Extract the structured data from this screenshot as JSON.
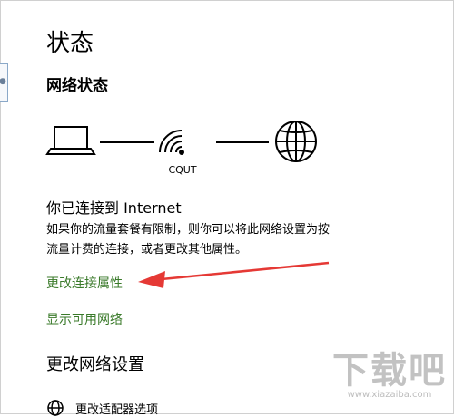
{
  "page": {
    "title": "状态"
  },
  "network_status": {
    "section_title": "网络状态",
    "ssid": "CQUT",
    "heading": "你已连接到 Internet",
    "description": "如果你的流量套餐有限制，则你可以将此网络设置为按流量计费的连接，或者更改其他属性。"
  },
  "links": {
    "change_properties": "更改连接属性",
    "show_networks": "显示可用网络"
  },
  "change_settings": {
    "section_title": "更改网络设置",
    "adapter_options": "更改适配器选项"
  },
  "watermark": {
    "logo_text": "下载吧",
    "url": "www.xiazaiba.com"
  },
  "colors": {
    "link": "#3a7a2a",
    "arrow": "#e53935",
    "text": "#000000"
  },
  "icons": {
    "computer": "laptop-icon",
    "wifi": "wifi-icon",
    "internet": "globe-icon",
    "adapter": "globe-icon"
  }
}
